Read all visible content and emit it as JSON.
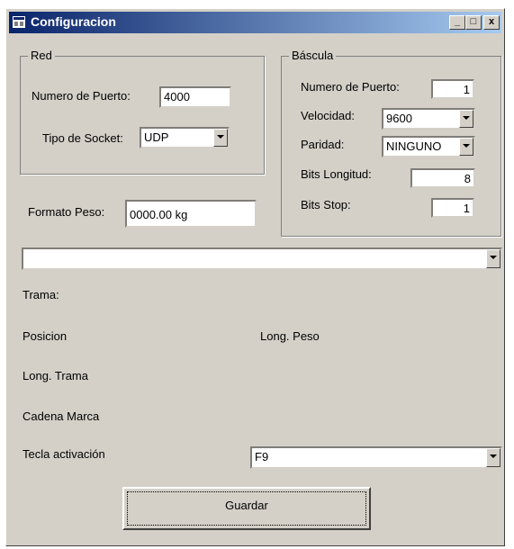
{
  "window": {
    "title": "Configuracion",
    "minimize": "_",
    "maximize": "□",
    "close": "x"
  },
  "red": {
    "group_label": "Red",
    "puerto_label": "Numero de Puerto:",
    "puerto_value": "4000",
    "socket_label": "Tipo de Socket:",
    "socket_value": "UDP"
  },
  "bascula": {
    "group_label": "Báscula",
    "puerto_label": "Numero de Puerto:",
    "puerto_value": "1",
    "velocidad_label": "Velocidad:",
    "velocidad_value": "9600",
    "paridad_label": "Paridad:",
    "paridad_value": "NINGUNO",
    "bits_longitud_label": "Bits Longitud:",
    "bits_longitud_value": "8",
    "bits_stop_label": "Bits Stop:",
    "bits_stop_value": "1"
  },
  "formato": {
    "label": "Formato Peso:",
    "value": "0000.00 kg"
  },
  "trama_combo_value": "",
  "labels": {
    "trama": "Trama:",
    "posicion": "Posicion",
    "long_peso": "Long. Peso",
    "long_trama": "Long. Trama",
    "cadena_marca": "Cadena Marca",
    "tecla": "Tecla activación"
  },
  "tecla_value": "F9",
  "guardar_label": "Guardar"
}
